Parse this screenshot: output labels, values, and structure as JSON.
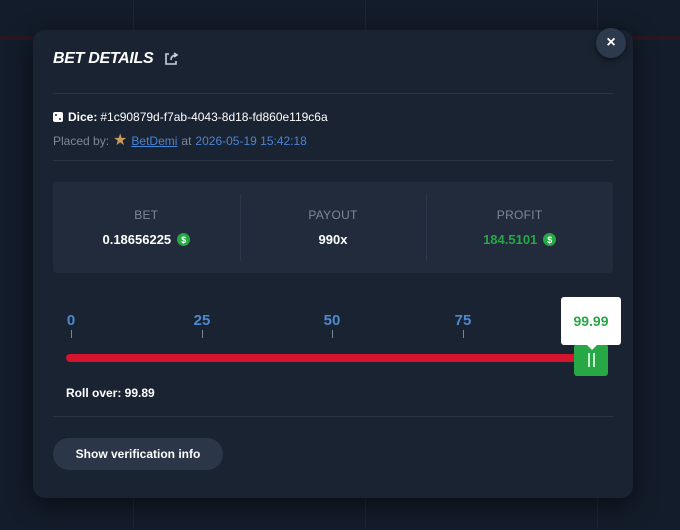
{
  "modal": {
    "title": "BET DETAILS",
    "close_label": "×"
  },
  "bet": {
    "id_label": "Dice:",
    "id": "#1c90879d-f7ab-4043-8d18-fd860e119c6a",
    "placed_by_label": "Placed by:",
    "user": "BetDemi",
    "at_label": "at",
    "timestamp": "2026-05-19 15:42:18"
  },
  "stats": [
    {
      "label": "BET",
      "value": "0.18656225",
      "coin": true
    },
    {
      "label": "PAYOUT",
      "value": "990x",
      "coin": false
    },
    {
      "label": "PROFIT",
      "value": "184.5101",
      "coin": true
    }
  ],
  "currency_icon": "dollar-coin-icon",
  "colors": {
    "profit": "#27a745",
    "track": "#d3142c",
    "handle": "#27a745",
    "tick_labels": "#4f89cf",
    "link": "#4a84d6"
  },
  "slider": {
    "ticks": [
      "0",
      "25",
      "50",
      "75"
    ],
    "value": "99.99",
    "value_number": 99.99
  },
  "roll": {
    "text": "Roll over: 99.89"
  },
  "actions": {
    "verify_label": "Show verification info"
  }
}
